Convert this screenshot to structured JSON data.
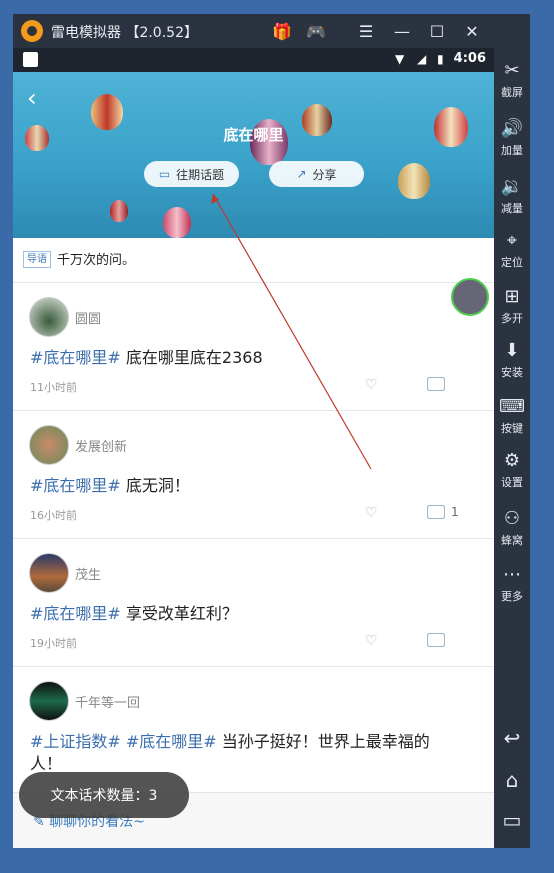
{
  "emulator": {
    "title": "雷电模拟器 【2.0.52】",
    "sidebar": [
      {
        "label": "截屏",
        "glyph": "✂"
      },
      {
        "label": "加量",
        "glyph": "🔊"
      },
      {
        "label": "减量",
        "glyph": "🔉"
      },
      {
        "label": "定位",
        "glyph": "⌖"
      },
      {
        "label": "多开",
        "glyph": "⊞"
      },
      {
        "label": "安装",
        "glyph": "⬇"
      },
      {
        "label": "按键",
        "glyph": "⌨"
      },
      {
        "label": "设置",
        "glyph": "⚙"
      },
      {
        "label": "蜂窝",
        "glyph": "⚇"
      },
      {
        "label": "更多",
        "glyph": "⋯"
      }
    ],
    "nav_glyphs": {
      "back": "↩",
      "home": "⌂",
      "recent": "▭"
    }
  },
  "statusbar": {
    "time": "4:06"
  },
  "topic": {
    "title": "底在哪里",
    "past_topics_label": "往期话题",
    "share_label": "分享",
    "guide_tag": "导语",
    "guide_text": "千万次的问。"
  },
  "posts": [
    {
      "user": "圆圆",
      "tag": "#底在哪里#",
      "text": " 底在哪里底在2368",
      "time": "11小时前",
      "comments": ""
    },
    {
      "user": "发展创新",
      "tag": "#底在哪里#",
      "text": " 底无洞！",
      "time": "16小时前",
      "comments": "1"
    },
    {
      "user": "茂生",
      "tag": "#底在哪里#",
      "text": " 享受改革红利？",
      "time": "19小时前",
      "comments": ""
    },
    {
      "user": "千年等一回",
      "tag": "#上证指数# #底在哪里#",
      "text": " 当孙子挺好！世界上最幸福的人！",
      "time": "",
      "comments": ""
    }
  ],
  "bottom": {
    "chat_placeholder": "聊聊你的看法~"
  },
  "toast": "文本话术数量：3",
  "colors": {
    "tag": "#3b6fb0",
    "accent": "#3b7bbf"
  }
}
